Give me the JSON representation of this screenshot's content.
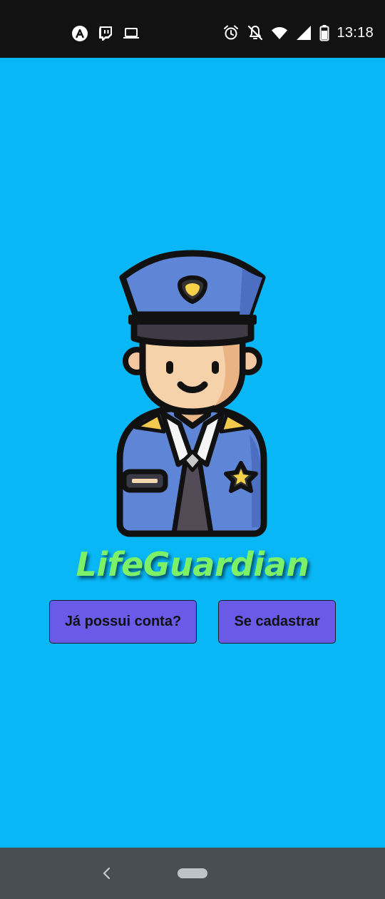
{
  "status_bar": {
    "time": "13:18",
    "left_icons": [
      "arc-app-icon",
      "twitch-icon",
      "laptop-icon"
    ],
    "right_icons": [
      "alarm-icon",
      "notifications-off-icon",
      "wifi-icon",
      "signal-icon",
      "battery-icon"
    ]
  },
  "app": {
    "title": "LifeGuardian",
    "avatar": "police-officer-icon"
  },
  "buttons": {
    "login_label": "Já possui conta?",
    "signup_label": "Se cadastrar"
  },
  "colors": {
    "background": "#09b6f6",
    "title": "#7cf067",
    "button": "#6a5ae8",
    "status_bar": "#121212",
    "nav_bar": "#474f55"
  },
  "nav_bar": {
    "icons": [
      "back-icon",
      "home-pill-icon"
    ]
  }
}
